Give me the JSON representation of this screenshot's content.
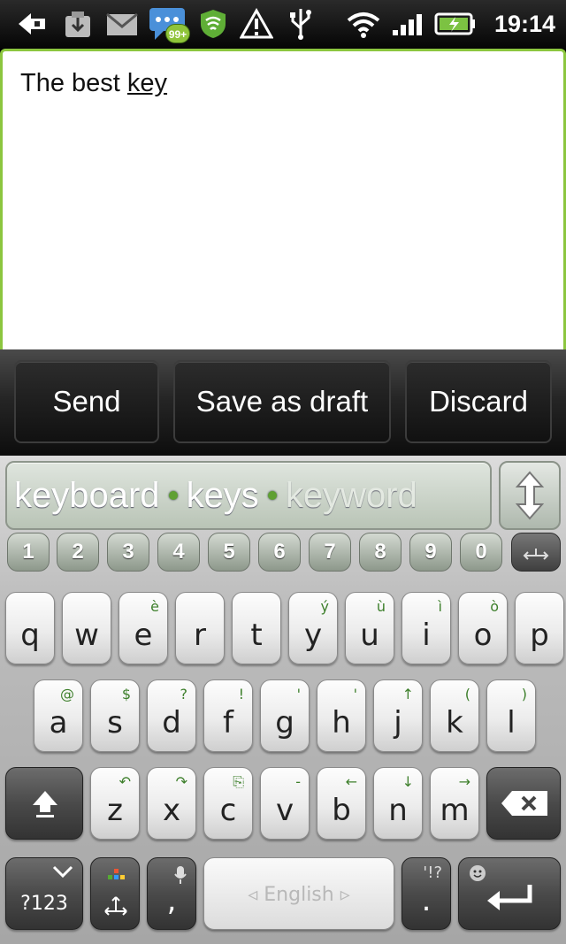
{
  "status_bar": {
    "time": "19:14",
    "notification_badge": "99+",
    "icons": [
      "back-arrow-icon",
      "download-icon",
      "gmail-icon",
      "talk-icon",
      "shield-icon",
      "warning-icon",
      "usb-icon",
      "wifi-icon",
      "signal-icon",
      "battery-icon"
    ]
  },
  "compose": {
    "text_before": "The best ",
    "text_composing": "key"
  },
  "actions": {
    "send": "Send",
    "save_draft": "Save as draft",
    "discard": "Discard"
  },
  "keyboard": {
    "suggestions": [
      "keyboard",
      "keys",
      "keyword"
    ],
    "numbers": [
      "1",
      "2",
      "3",
      "4",
      "5",
      "6",
      "7",
      "8",
      "9",
      "0"
    ],
    "row1": [
      {
        "main": "q",
        "alt": ""
      },
      {
        "main": "w",
        "alt": ""
      },
      {
        "main": "e",
        "alt": "è"
      },
      {
        "main": "r",
        "alt": ""
      },
      {
        "main": "t",
        "alt": ""
      },
      {
        "main": "y",
        "alt": "ý"
      },
      {
        "main": "u",
        "alt": "ù"
      },
      {
        "main": "i",
        "alt": "ì"
      },
      {
        "main": "o",
        "alt": "ò"
      },
      {
        "main": "p",
        "alt": ""
      }
    ],
    "row2": [
      {
        "main": "a",
        "alt": "@"
      },
      {
        "main": "s",
        "alt": "$"
      },
      {
        "main": "d",
        "alt": "?"
      },
      {
        "main": "f",
        "alt": "!"
      },
      {
        "main": "g",
        "alt": "'"
      },
      {
        "main": "h",
        "alt": "'"
      },
      {
        "main": "j",
        "alt": "↑"
      },
      {
        "main": "k",
        "alt": "("
      },
      {
        "main": "l",
        "alt": ")"
      }
    ],
    "row3": [
      {
        "main": "z",
        "alt": "↶"
      },
      {
        "main": "x",
        "alt": "↷"
      },
      {
        "main": "c",
        "alt": "⎘"
      },
      {
        "main": "v",
        "alt": "-"
      },
      {
        "main": "b",
        "alt": "←"
      },
      {
        "main": "n",
        "alt": "↓"
      },
      {
        "main": "m",
        "alt": "→"
      }
    ],
    "symbols_label": "?123",
    "comma": ",",
    "space_label": "◃ English ▹",
    "period": ".",
    "period_alt": "'!?",
    "accent_color": "#8cc63f"
  }
}
